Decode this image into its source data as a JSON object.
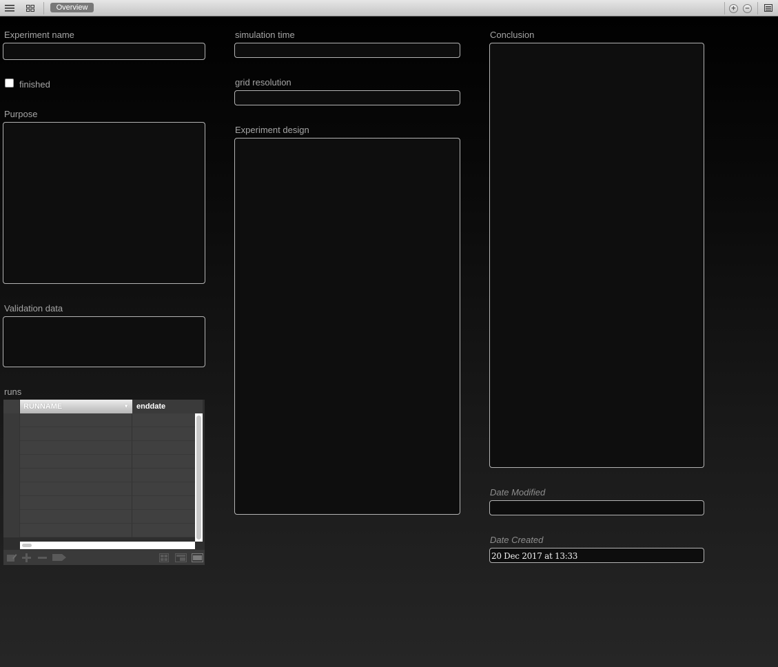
{
  "toolbar": {
    "tab_label": "Overview",
    "icons": [
      "list-view-icon",
      "grid-view-icon",
      "add-circle-icon",
      "remove-circle-icon",
      "detail-view-icon"
    ]
  },
  "form": {
    "experiment_name": {
      "label": "Experiment name",
      "value": ""
    },
    "finished": {
      "label": "finished",
      "checked": false
    },
    "purpose": {
      "label": "Purpose",
      "value": ""
    },
    "validation_data": {
      "label": "Validation data",
      "value": ""
    },
    "simulation_time": {
      "label": "simulation time",
      "value": ""
    },
    "grid_resolution": {
      "label": "grid resolution",
      "value": ""
    },
    "experiment_design": {
      "label": "Experiment design",
      "value": ""
    },
    "conclusion": {
      "label": "Conclusion",
      "value": ""
    },
    "date_modified": {
      "label": "Date Modified",
      "value": ""
    },
    "date_created": {
      "label": "Date Created",
      "value": "20 Dec 2017 at 13:33"
    }
  },
  "runs": {
    "label": "runs",
    "columns": [
      "RUNNAME",
      "enddate"
    ],
    "rows": [],
    "footer_icons": [
      "edit-record-icon",
      "add-record-icon",
      "delete-record-icon",
      "go-to-record-icon",
      "grid-layout-icon",
      "form-layout-icon",
      "list-layout-icon"
    ]
  },
  "colors": {
    "background_top": "#000000",
    "background_bottom": "#262626",
    "label_text": "#a6a6a6",
    "field_border": "#b4b4b4",
    "tab_bg": "#787878"
  }
}
